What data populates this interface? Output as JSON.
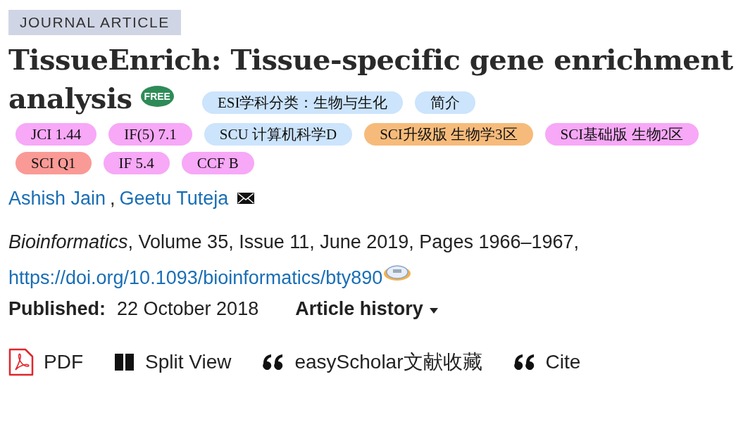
{
  "article_type": "JOURNAL ARTICLE",
  "title_lines": [
    "TissueEnrich: Tissue-specific gene enrichment",
    "analysis"
  ],
  "free_badge": "FREE",
  "tags": [
    {
      "label": "ESI学科分类：生物与生化",
      "color": "#cce4fc"
    },
    {
      "label": "简介",
      "color": "#cce4fc"
    },
    {
      "label": "JCI 1.44",
      "color": "#f7a8f7"
    },
    {
      "label": "IF(5) 7.1",
      "color": "#f7a8f7"
    },
    {
      "label": "SCU 计算机科学D",
      "color": "#cce4fc"
    },
    {
      "label": "SCI升级版 生物学3区",
      "color": "#f6bb7b"
    },
    {
      "label": "SCI基础版 生物2区",
      "color": "#f7a8f7"
    },
    {
      "label": "SCI Q1",
      "color": "#fa9a96"
    },
    {
      "label": "IF 5.4",
      "color": "#f7a8f7"
    },
    {
      "label": "CCF B",
      "color": "#f7a8f7"
    }
  ],
  "authors": [
    "Ashish Jain",
    "Geetu Tuteja"
  ],
  "author_separator": ",",
  "citation": "*Bioinformatics*, Volume 35, Issue 11, June 2019, Pages 1966–1967,",
  "doi": "https://doi.org/10.1093/bioinformatics/bty890",
  "published_label": "Published:",
  "published_date": "22 October 2018",
  "history": "Article history",
  "actions": [
    {
      "kind": "pdf",
      "label": "PDF"
    },
    {
      "kind": "split",
      "label": "Split View"
    },
    {
      "kind": "quote",
      "label": "easyScholar文献收藏"
    },
    {
      "kind": "quote",
      "label": "Cite"
    }
  ]
}
